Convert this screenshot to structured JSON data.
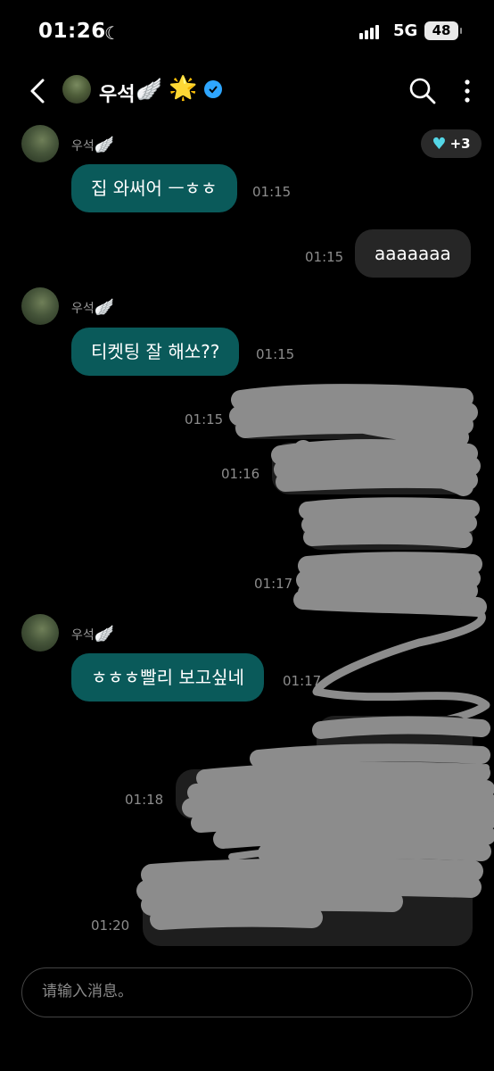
{
  "status_bar": {
    "time": "01:26",
    "focus_icon": "moon-icon",
    "network": "5G",
    "battery": "48"
  },
  "header": {
    "contact_name": "우석",
    "name_emoji": "🪽",
    "star_emoji": "🌟",
    "verified_icon": "verified-check-icon",
    "reaction_count": "+3"
  },
  "messages": [
    {
      "sender": "우석",
      "wing": "🪽",
      "text": "집 와써어 ㅡㅎㅎ",
      "time": "01:15",
      "dir": "in"
    },
    {
      "text": "aaaaaaa",
      "time": "01:15",
      "dir": "out"
    },
    {
      "sender": "우석",
      "wing": "🪽",
      "text": "티켓팅 잘 해쏘??",
      "time": "01:15",
      "dir": "in"
    },
    {
      "text": "",
      "time": "01:15",
      "dir": "out",
      "redacted": true
    },
    {
      "text": "",
      "time": "01:16",
      "dir": "out",
      "redacted": true
    },
    {
      "text": "",
      "time": "01:17",
      "dir": "out",
      "redacted": true
    },
    {
      "sender": "우석",
      "wing": "🪽",
      "text": "ㅎㅎㅎ빨리 보고싶네",
      "time": "01:17",
      "dir": "in"
    },
    {
      "text": "",
      "time": "01:18",
      "dir": "out",
      "redacted": true
    },
    {
      "text": "",
      "time": "01:20",
      "dir": "out",
      "redacted": true
    }
  ],
  "composer": {
    "placeholder": "请输入消息。"
  },
  "colors": {
    "incoming_bubble": "#0a5a5a",
    "outgoing_bubble": "#262626",
    "background": "#000000",
    "scribble": "#8c8c8c"
  }
}
